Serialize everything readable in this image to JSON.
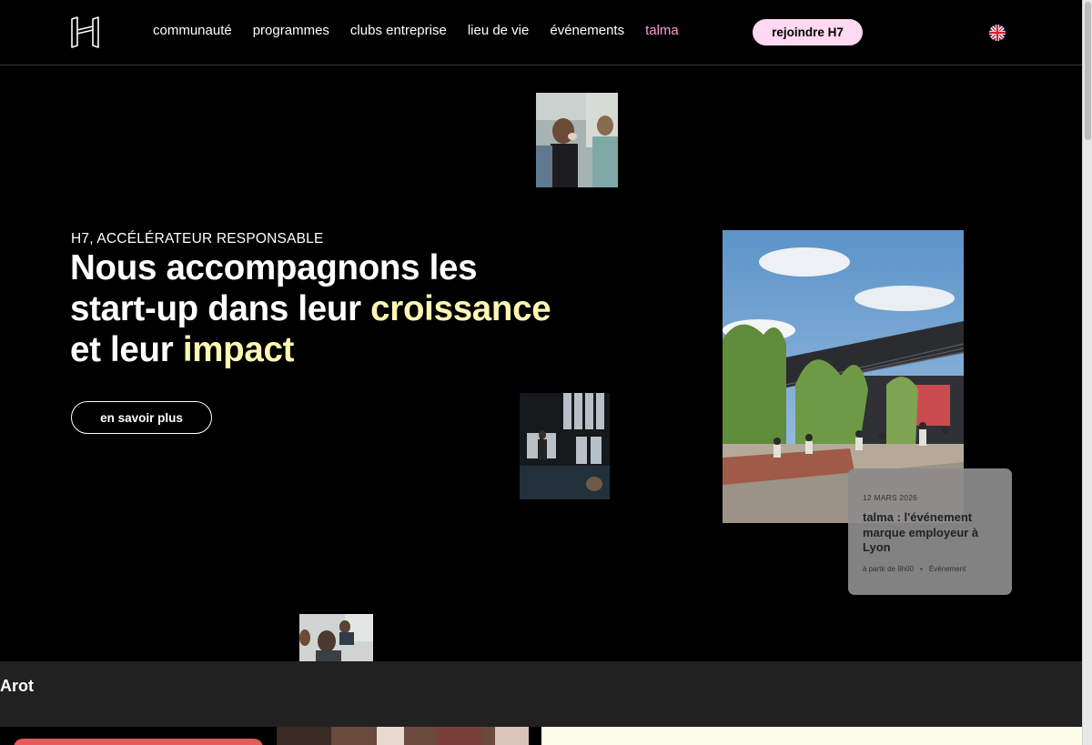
{
  "header": {
    "logo_name": "H7 logo",
    "nav": [
      {
        "label": "communauté"
      },
      {
        "label": "programmes"
      },
      {
        "label": "clubs entreprise"
      },
      {
        "label": "lieu de vie"
      },
      {
        "label": "événements"
      },
      {
        "label": "talma"
      }
    ],
    "join_label": "rejoindre H7",
    "language_icon": "uk-flag-icon"
  },
  "hero": {
    "eyebrow": "H7, ACCÉLÉRATEUR RESPONSABLE",
    "headline_part1": "Nous accompagnons les",
    "headline_part2": "start-up dans leur ",
    "headline_highlight1": "croissance",
    "headline_part3": "et leur ",
    "headline_highlight2": "impact",
    "cta_label": "en savoir plus"
  },
  "event": {
    "date": "12 MARS 2026",
    "title": "talma : l'événement marque employeur à Lyon",
    "time": "à partir de 9h00",
    "separator": "•",
    "category": "Événement"
  },
  "band": {
    "partner_text": "Arot"
  },
  "colors": {
    "background": "#000000",
    "highlight": "#fff6b4",
    "pink_link": "#ff9ad5",
    "join_button": "#ffd9f1",
    "band": "#212121"
  }
}
